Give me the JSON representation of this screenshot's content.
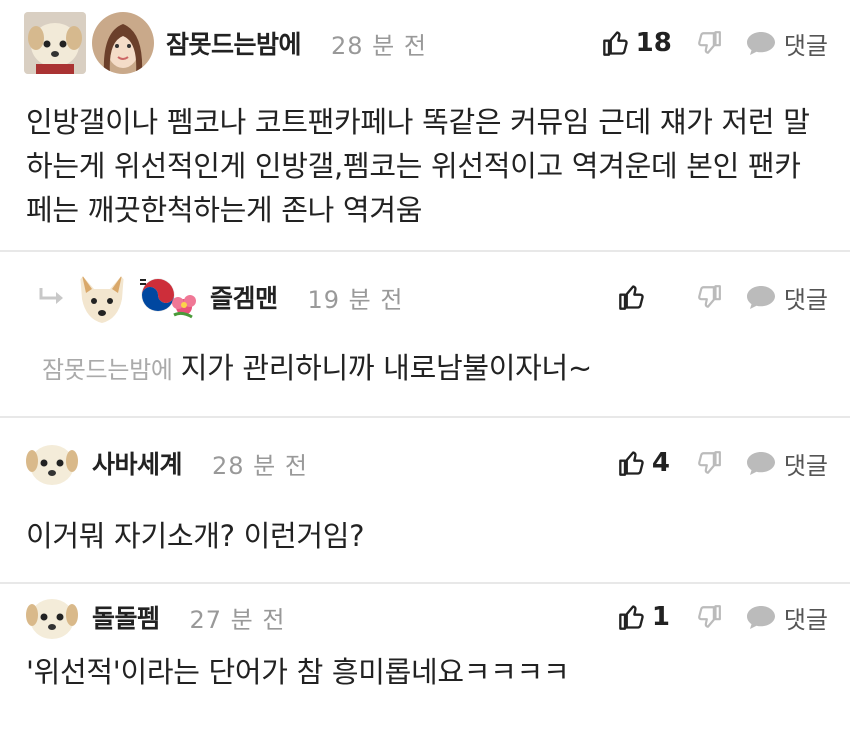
{
  "comments": [
    {
      "nickname": "잠못드는밤에",
      "time": "28 분 전",
      "likes": "18",
      "reply_label": "댓글",
      "text": "인방갤이나 펨코나 코트팬카페나 똑같은 커뮤임 근데 쟤가 저런 말 하는게 위선적인게 인방갤,펨코는 위선적이고 역겨운데 본인 팬카페는 깨끗한척하는게 존나 역겨움"
    },
    {
      "nickname": "즐겜맨",
      "time": "19 분 전",
      "likes": "",
      "reply_label": "댓글",
      "mention": "잠못드는밤에",
      "text": "지가 관리하니까 내로남불이자너~"
    },
    {
      "nickname": "사바세계",
      "time": "28 분 전",
      "likes": "4",
      "reply_label": "댓글",
      "text": "이거뭐 자기소개? 이런거임?"
    },
    {
      "nickname": "돌돌펨",
      "time": "27 분 전",
      "likes": "1",
      "reply_label": "댓글",
      "text": "'위선적'이라는 단어가 참 흥미롭네요ㅋㅋㅋㅋ"
    }
  ],
  "icons": {
    "like": "thumbs-up-icon",
    "dislike": "thumbs-down-icon",
    "reply": "speech-bubble-icon",
    "reply_indicator": "reply-arrow-icon"
  },
  "colors": {
    "text": "#222222",
    "muted": "#999999",
    "divider": "#e8e8e8"
  }
}
